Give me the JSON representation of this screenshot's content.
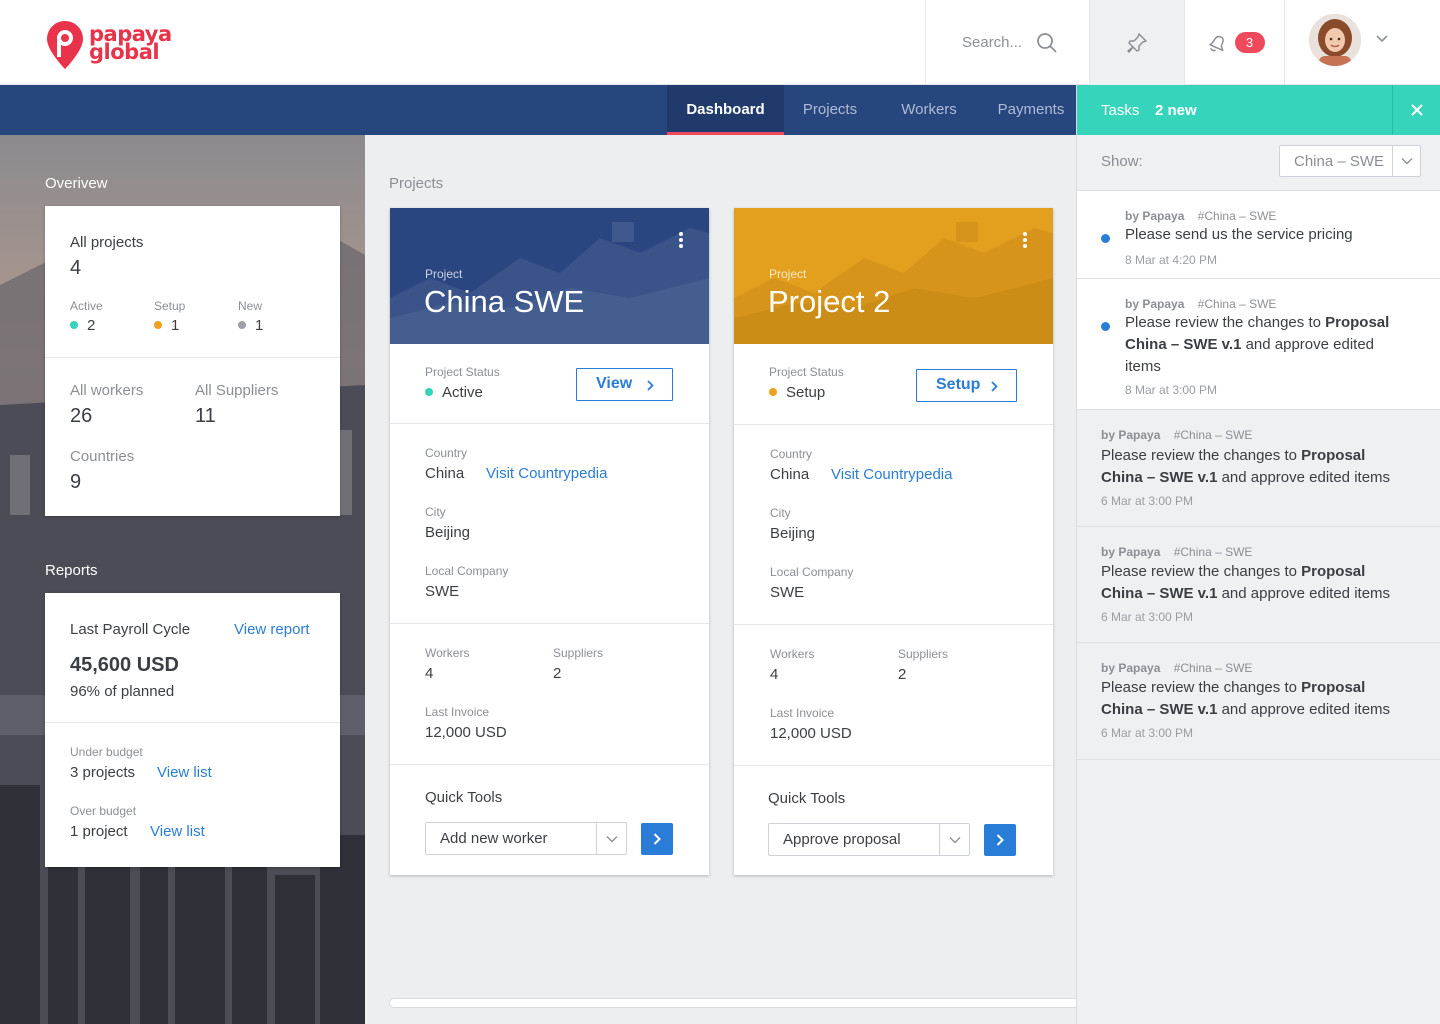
{
  "brand": {
    "logo_line1": "papaya",
    "logo_line2": "global"
  },
  "header": {
    "search_placeholder": "Search...",
    "notification_count": "3"
  },
  "nav": {
    "tabs": [
      "Dashboard",
      "Projects",
      "Workers",
      "Payments"
    ],
    "active": "Dashboard"
  },
  "overview": {
    "title": "Overivew",
    "all_projects_label": "All projects",
    "all_projects_value": "4",
    "statuses": [
      {
        "label": "Active",
        "value": "2",
        "color": "#35d4bb"
      },
      {
        "label": "Setup",
        "value": "1",
        "color": "#f0a020"
      },
      {
        "label": "New",
        "value": "1",
        "color": "#9b9fa8"
      }
    ],
    "all_workers_label": "All workers",
    "all_workers_value": "26",
    "all_suppliers_label": "All Suppliers",
    "all_suppliers_value": "11",
    "countries_label": "Countries",
    "countries_value": "9"
  },
  "reports": {
    "title": "Reports",
    "last_payroll_label": "Last Payroll Cycle",
    "view_report": "View report",
    "amount": "45,600 USD",
    "planned": "96% of planned",
    "under_budget_label": "Under budget",
    "under_budget_value": "3 projects",
    "over_budget_label": "Over budget",
    "over_budget_value": "1 project",
    "view_list": "View list"
  },
  "projects": {
    "title": "Projects",
    "cards": [
      {
        "banner_color": "#2a4680",
        "kicker": "Project",
        "name": "China SWE",
        "status_label": "Project Status",
        "status": "Active",
        "status_color": "#35d4bb",
        "button": "View",
        "country_label": "Country",
        "country": "China",
        "countrypedia": "Visit Countrypedia",
        "city_label": "City",
        "city": "Beijing",
        "company_label": "Local Company",
        "company": "SWE",
        "workers_label": "Workers",
        "workers": "4",
        "suppliers_label": "Suppliers",
        "suppliers": "2",
        "invoice_label": "Last Invoice",
        "invoice": "12,000 USD",
        "tools_label": "Quick Tools",
        "tool": "Add new worker"
      },
      {
        "banner_color": "#e3a01e",
        "kicker": "Project",
        "name": "Project 2",
        "status_label": "Project Status",
        "status": "Setup",
        "status_color": "#f0a020",
        "button": "Setup",
        "country_label": "Country",
        "country": "China",
        "countrypedia": "Visit Countrypedia",
        "city_label": "City",
        "city": "Beijing",
        "company_label": "Local Company",
        "company": "SWE",
        "workers_label": "Workers",
        "workers": "4",
        "suppliers_label": "Suppliers",
        "suppliers": "2",
        "invoice_label": "Last Invoice",
        "invoice": "12,000 USD",
        "tools_label": "Quick Tools",
        "tool": "Approve proposal"
      }
    ]
  },
  "tasks": {
    "title": "Tasks",
    "new_count": "2 new",
    "show_label": "Show:",
    "filter": "China – SWE",
    "items": [
      {
        "author": "by Papaya",
        "tag": "#China – SWE",
        "text": "Please send us the service pricing",
        "time": "8 Mar at 4:20 PM"
      },
      {
        "author": "by Papaya",
        "tag": "#China – SWE",
        "text_pre": "Please review the changes to ",
        "text_bold": "Proposal China – SWE v.1",
        "text_post": " and approve edited items",
        "time": "8 Mar at 3:00 PM"
      },
      {
        "author": "by Papaya",
        "tag": "#China – SWE",
        "text_pre": "Please review the changes to ",
        "text_bold": "Proposal China – SWE v.1",
        "text_post": " and approve edited items",
        "time": "6 Mar at 3:00 PM"
      },
      {
        "author": "by Papaya",
        "tag": "#China – SWE",
        "text_pre": "Please review the changes to ",
        "text_bold": "Proposal China – SWE v.1",
        "text_post": " and approve edited items",
        "time": "6 Mar at 3:00 PM"
      },
      {
        "author": "by Papaya",
        "tag": "#China – SWE",
        "text_pre": "Please review the changes to ",
        "text_bold": "Proposal China – SWE v.1",
        "text_post": " and approve edited items",
        "time": "6 Mar at 3:00 PM"
      }
    ]
  },
  "icons": [
    "logo-pin-icon",
    "search-icon",
    "pin-icon",
    "bell-icon",
    "avatar",
    "chevron-down-icon",
    "close-icon",
    "kebab-icon",
    "chevron-right-icon"
  ]
}
